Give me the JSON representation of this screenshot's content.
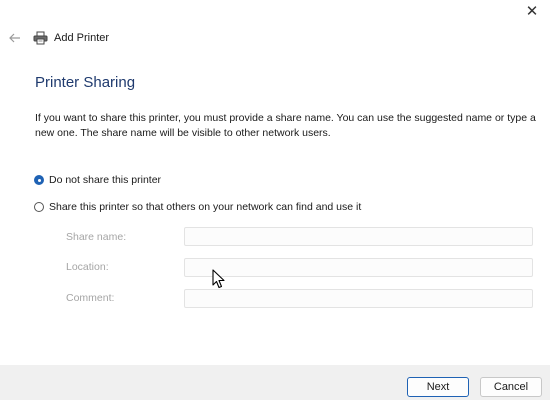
{
  "window": {
    "title": "Add Printer",
    "close_glyph": "✕"
  },
  "page": {
    "heading": "Printer Sharing",
    "description": "If you want to share this printer, you must provide a share name. You can use the suggested name or type a new one. The share name will be visible to other network users."
  },
  "sharing_options": [
    {
      "label": "Do not share this printer",
      "selected": true
    },
    {
      "label": "Share this printer so that others on your network can find and use it",
      "selected": false
    }
  ],
  "fields": {
    "share_name": {
      "label": "Share name:",
      "value": ""
    },
    "location": {
      "label": "Location:",
      "value": ""
    },
    "comment": {
      "label": "Comment:",
      "value": ""
    }
  },
  "buttons": {
    "next": "Next",
    "cancel": "Cancel"
  },
  "icons": {
    "back": "back-arrow-icon",
    "printer": "printer-icon",
    "close": "close-icon"
  },
  "colors": {
    "heading": "#1f3a6e",
    "accent": "#1f62b4",
    "footer_bg": "#f0f0f0"
  }
}
